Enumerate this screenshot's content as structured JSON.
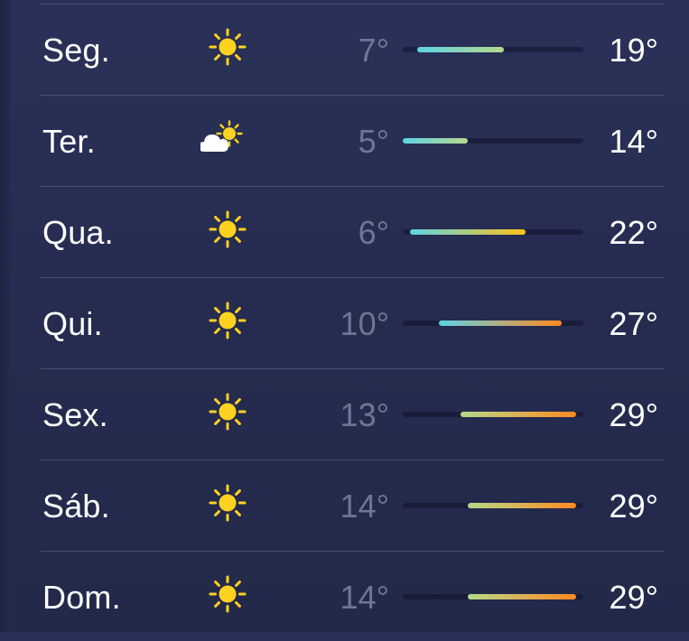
{
  "forecast": {
    "days": [
      {
        "day": "Seg.",
        "icon": "sun-icon",
        "low": "7°",
        "high": "19°",
        "range_min": 7,
        "range_max": 19
      },
      {
        "day": "Ter.",
        "icon": "partly-cloudy-icon",
        "low": "5°",
        "high": "14°",
        "range_min": 5,
        "range_max": 14
      },
      {
        "day": "Qua.",
        "icon": "sun-icon",
        "low": "6°",
        "high": "22°",
        "range_min": 6,
        "range_max": 22
      },
      {
        "day": "Qui.",
        "icon": "sun-icon",
        "low": "10°",
        "high": "27°",
        "range_min": 10,
        "range_max": 27
      },
      {
        "day": "Sex.",
        "icon": "sun-icon",
        "low": "13°",
        "high": "29°",
        "range_min": 13,
        "range_max": 29
      },
      {
        "day": "Sáb.",
        "icon": "sun-icon",
        "low": "14°",
        "high": "29°",
        "range_min": 14,
        "range_max": 29
      },
      {
        "day": "Dom.",
        "icon": "sun-icon",
        "low": "14°",
        "high": "29°",
        "range_min": 14,
        "range_max": 29
      }
    ],
    "scale_min": 5,
    "scale_max": 30
  },
  "colors": {
    "sun": "#ffd21f",
    "cloud": "#ffffff",
    "cool": "#5fd3e6",
    "mild": "#b6d98a",
    "warm": "#ffc21a",
    "hot": "#ff8a1f"
  }
}
